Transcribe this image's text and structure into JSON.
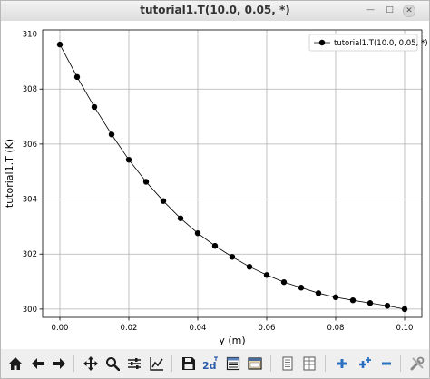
{
  "window": {
    "title": "tutorial1.T(10.0, 0.05, *)"
  },
  "chart_data": {
    "type": "line",
    "xlabel": "y (m)",
    "ylabel": "tutorial1.T (K)",
    "xlim": [
      -0.005,
      0.105
    ],
    "ylim": [
      299.7,
      310.15
    ],
    "xticks": [
      "0.00",
      "0.02",
      "0.04",
      "0.06",
      "0.08",
      "0.10"
    ],
    "yticks": [
      "300",
      "302",
      "304",
      "306",
      "308",
      "310"
    ],
    "grid": true,
    "legend_position": "top-right",
    "series": [
      {
        "name": "tutorial1.T(10.0, 0.05, *)",
        "color": "#000000",
        "marker": "circle",
        "x": [
          0.0,
          0.005,
          0.01,
          0.015,
          0.02,
          0.025,
          0.03,
          0.035,
          0.04,
          0.045,
          0.05,
          0.055,
          0.06,
          0.065,
          0.07,
          0.075,
          0.08,
          0.085,
          0.09,
          0.095,
          0.1
        ],
        "y": [
          309.62,
          308.44,
          307.35,
          306.35,
          305.43,
          304.63,
          303.93,
          303.3,
          302.76,
          302.3,
          301.9,
          301.54,
          301.24,
          300.98,
          300.78,
          300.58,
          300.43,
          300.32,
          300.22,
          300.12,
          300.0
        ]
      }
    ]
  },
  "toolbar": {
    "buttons": [
      {
        "name": "home-button",
        "icon": "home-icon"
      },
      {
        "name": "back-button",
        "icon": "arrow-left-icon"
      },
      {
        "name": "forward-button",
        "icon": "arrow-right-icon"
      },
      {
        "name": "pan-button",
        "icon": "move-icon"
      },
      {
        "name": "zoom-button",
        "icon": "magnifier-icon"
      },
      {
        "name": "subplots-button",
        "icon": "sliders-icon"
      },
      {
        "name": "edit-axes-button",
        "icon": "line-chart-icon"
      },
      {
        "name": "save-button",
        "icon": "floppy-icon"
      },
      {
        "name": "plot-2d-button",
        "icon": "2d-icon"
      },
      {
        "name": "view-data-button",
        "icon": "table-icon"
      },
      {
        "name": "image-button",
        "icon": "image-icon"
      },
      {
        "name": "list-button",
        "icon": "list-icon"
      },
      {
        "name": "grid-view-button",
        "icon": "grid-icon"
      },
      {
        "name": "add-button",
        "icon": "plus-icon"
      },
      {
        "name": "add-multiple-button",
        "icon": "plus-multiple-icon"
      },
      {
        "name": "remove-button",
        "icon": "minus-icon"
      },
      {
        "name": "settings-button",
        "icon": "tools-icon"
      }
    ],
    "labels": {
      "plot_2d": "2d"
    }
  }
}
